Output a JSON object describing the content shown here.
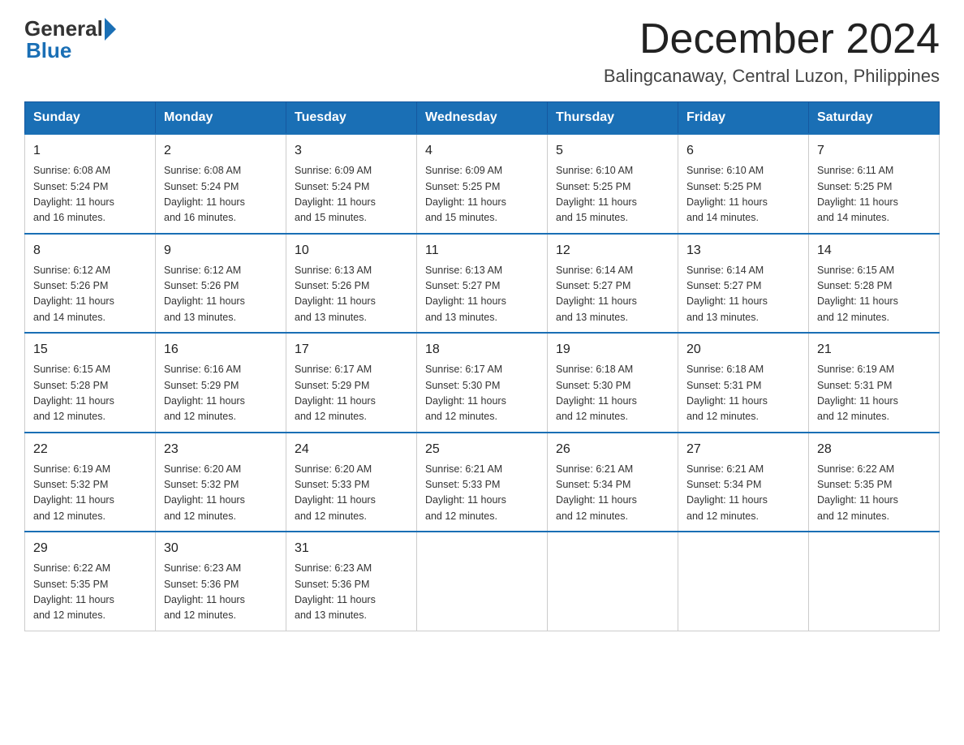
{
  "header": {
    "logo_general": "General",
    "logo_blue": "Blue",
    "month_title": "December 2024",
    "location": "Balingcanaway, Central Luzon, Philippines"
  },
  "days_of_week": [
    "Sunday",
    "Monday",
    "Tuesday",
    "Wednesday",
    "Thursday",
    "Friday",
    "Saturday"
  ],
  "weeks": [
    [
      {
        "day": "1",
        "sunrise": "6:08 AM",
        "sunset": "5:24 PM",
        "daylight": "11 hours and 16 minutes."
      },
      {
        "day": "2",
        "sunrise": "6:08 AM",
        "sunset": "5:24 PM",
        "daylight": "11 hours and 16 minutes."
      },
      {
        "day": "3",
        "sunrise": "6:09 AM",
        "sunset": "5:24 PM",
        "daylight": "11 hours and 15 minutes."
      },
      {
        "day": "4",
        "sunrise": "6:09 AM",
        "sunset": "5:25 PM",
        "daylight": "11 hours and 15 minutes."
      },
      {
        "day": "5",
        "sunrise": "6:10 AM",
        "sunset": "5:25 PM",
        "daylight": "11 hours and 15 minutes."
      },
      {
        "day": "6",
        "sunrise": "6:10 AM",
        "sunset": "5:25 PM",
        "daylight": "11 hours and 14 minutes."
      },
      {
        "day": "7",
        "sunrise": "6:11 AM",
        "sunset": "5:25 PM",
        "daylight": "11 hours and 14 minutes."
      }
    ],
    [
      {
        "day": "8",
        "sunrise": "6:12 AM",
        "sunset": "5:26 PM",
        "daylight": "11 hours and 14 minutes."
      },
      {
        "day": "9",
        "sunrise": "6:12 AM",
        "sunset": "5:26 PM",
        "daylight": "11 hours and 13 minutes."
      },
      {
        "day": "10",
        "sunrise": "6:13 AM",
        "sunset": "5:26 PM",
        "daylight": "11 hours and 13 minutes."
      },
      {
        "day": "11",
        "sunrise": "6:13 AM",
        "sunset": "5:27 PM",
        "daylight": "11 hours and 13 minutes."
      },
      {
        "day": "12",
        "sunrise": "6:14 AM",
        "sunset": "5:27 PM",
        "daylight": "11 hours and 13 minutes."
      },
      {
        "day": "13",
        "sunrise": "6:14 AM",
        "sunset": "5:27 PM",
        "daylight": "11 hours and 13 minutes."
      },
      {
        "day": "14",
        "sunrise": "6:15 AM",
        "sunset": "5:28 PM",
        "daylight": "11 hours and 12 minutes."
      }
    ],
    [
      {
        "day": "15",
        "sunrise": "6:15 AM",
        "sunset": "5:28 PM",
        "daylight": "11 hours and 12 minutes."
      },
      {
        "day": "16",
        "sunrise": "6:16 AM",
        "sunset": "5:29 PM",
        "daylight": "11 hours and 12 minutes."
      },
      {
        "day": "17",
        "sunrise": "6:17 AM",
        "sunset": "5:29 PM",
        "daylight": "11 hours and 12 minutes."
      },
      {
        "day": "18",
        "sunrise": "6:17 AM",
        "sunset": "5:30 PM",
        "daylight": "11 hours and 12 minutes."
      },
      {
        "day": "19",
        "sunrise": "6:18 AM",
        "sunset": "5:30 PM",
        "daylight": "11 hours and 12 minutes."
      },
      {
        "day": "20",
        "sunrise": "6:18 AM",
        "sunset": "5:31 PM",
        "daylight": "11 hours and 12 minutes."
      },
      {
        "day": "21",
        "sunrise": "6:19 AM",
        "sunset": "5:31 PM",
        "daylight": "11 hours and 12 minutes."
      }
    ],
    [
      {
        "day": "22",
        "sunrise": "6:19 AM",
        "sunset": "5:32 PM",
        "daylight": "11 hours and 12 minutes."
      },
      {
        "day": "23",
        "sunrise": "6:20 AM",
        "sunset": "5:32 PM",
        "daylight": "11 hours and 12 minutes."
      },
      {
        "day": "24",
        "sunrise": "6:20 AM",
        "sunset": "5:33 PM",
        "daylight": "11 hours and 12 minutes."
      },
      {
        "day": "25",
        "sunrise": "6:21 AM",
        "sunset": "5:33 PM",
        "daylight": "11 hours and 12 minutes."
      },
      {
        "day": "26",
        "sunrise": "6:21 AM",
        "sunset": "5:34 PM",
        "daylight": "11 hours and 12 minutes."
      },
      {
        "day": "27",
        "sunrise": "6:21 AM",
        "sunset": "5:34 PM",
        "daylight": "11 hours and 12 minutes."
      },
      {
        "day": "28",
        "sunrise": "6:22 AM",
        "sunset": "5:35 PM",
        "daylight": "11 hours and 12 minutes."
      }
    ],
    [
      {
        "day": "29",
        "sunrise": "6:22 AM",
        "sunset": "5:35 PM",
        "daylight": "11 hours and 12 minutes."
      },
      {
        "day": "30",
        "sunrise": "6:23 AM",
        "sunset": "5:36 PM",
        "daylight": "11 hours and 12 minutes."
      },
      {
        "day": "31",
        "sunrise": "6:23 AM",
        "sunset": "5:36 PM",
        "daylight": "11 hours and 13 minutes."
      },
      null,
      null,
      null,
      null
    ]
  ]
}
